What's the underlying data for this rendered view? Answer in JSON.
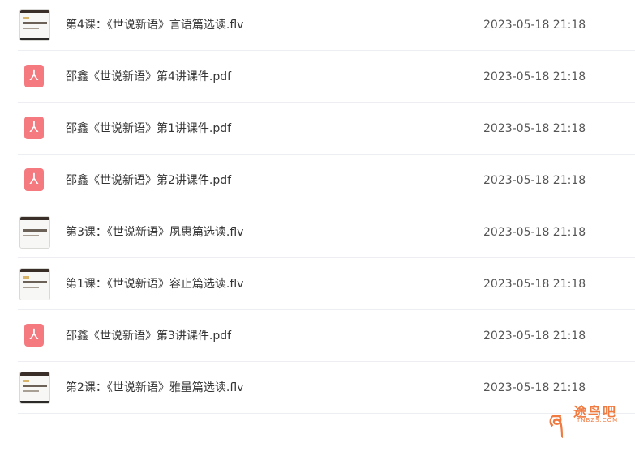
{
  "files": [
    {
      "type": "video",
      "name": "第4课：《世说新语》言语篇选读.flv",
      "date": "2023-05-18 21:18"
    },
    {
      "type": "pdf",
      "name": "邵鑫《世说新语》第4讲课件.pdf",
      "date": "2023-05-18 21:18"
    },
    {
      "type": "pdf",
      "name": "邵鑫《世说新语》第1讲课件.pdf",
      "date": "2023-05-18 21:18"
    },
    {
      "type": "pdf",
      "name": "邵鑫《世说新语》第2讲课件.pdf",
      "date": "2023-05-18 21:18"
    },
    {
      "type": "video",
      "name": "第3课：《世说新语》夙惠篇选读.flv",
      "date": "2023-05-18 21:18"
    },
    {
      "type": "video",
      "name": "第1课：《世说新语》容止篇选读.flv",
      "date": "2023-05-18 21:18"
    },
    {
      "type": "pdf",
      "name": "邵鑫《世说新语》第3讲课件.pdf",
      "date": "2023-05-18 21:18"
    },
    {
      "type": "video",
      "name": "第2课：《世说新语》雅量篇选读.flv",
      "date": "2023-05-18 21:18"
    }
  ],
  "watermark": {
    "cn": "途鸟吧",
    "en": "TNBZS.COM",
    "icon": "bird-logo-icon"
  },
  "colors": {
    "pdf_icon": "#f47a80",
    "divider": "#eceef2",
    "watermark": "#f07a40"
  }
}
